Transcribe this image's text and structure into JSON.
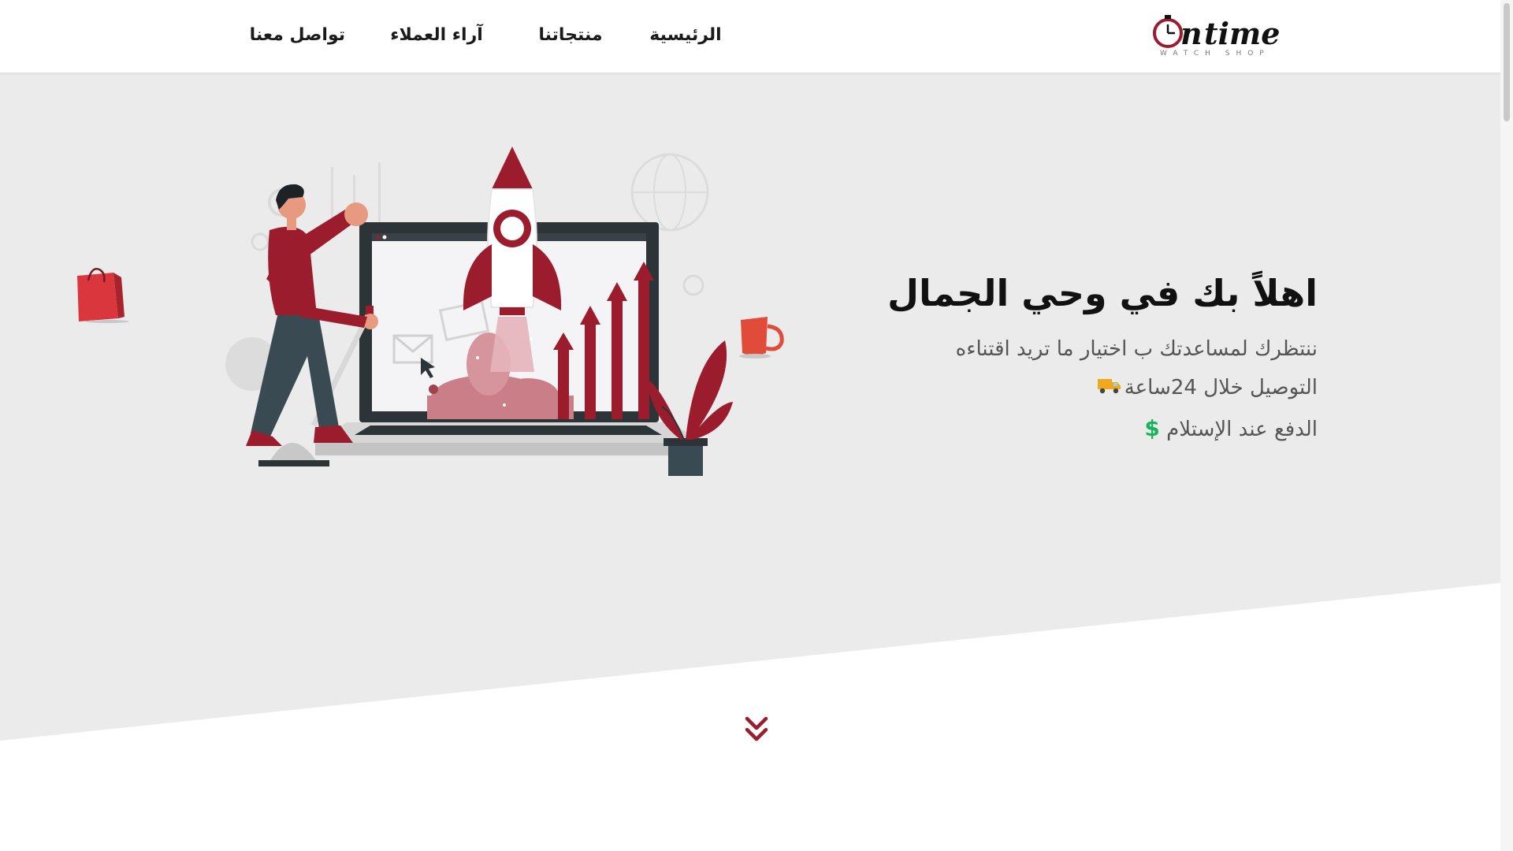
{
  "brand": {
    "logo_text": "On time",
    "logo_tagline": "WATCH SHOP"
  },
  "nav": {
    "home": "الرئيسية",
    "products": "منتجاتنا",
    "reviews": "آراء العملاء",
    "contact": "تواصل معنا"
  },
  "hero": {
    "title": "اهلاً بك في وحي الجمال",
    "line1": "ننتظرك لمساعدتك ب اختيار ما تريد اقتناءه",
    "line2": "التوصيل خلال 24ساعة",
    "line3": "الدفع عند الإستلام",
    "dollar_symbol": "$"
  },
  "icons": {
    "truck": "delivery-truck-icon",
    "dollar": "dollar-icon",
    "scroll": "double-chevron-down-icon"
  },
  "colors": {
    "accent": "#9b1c2c",
    "hero_bg": "#ebebeb",
    "dollar_green": "#16b35a"
  }
}
